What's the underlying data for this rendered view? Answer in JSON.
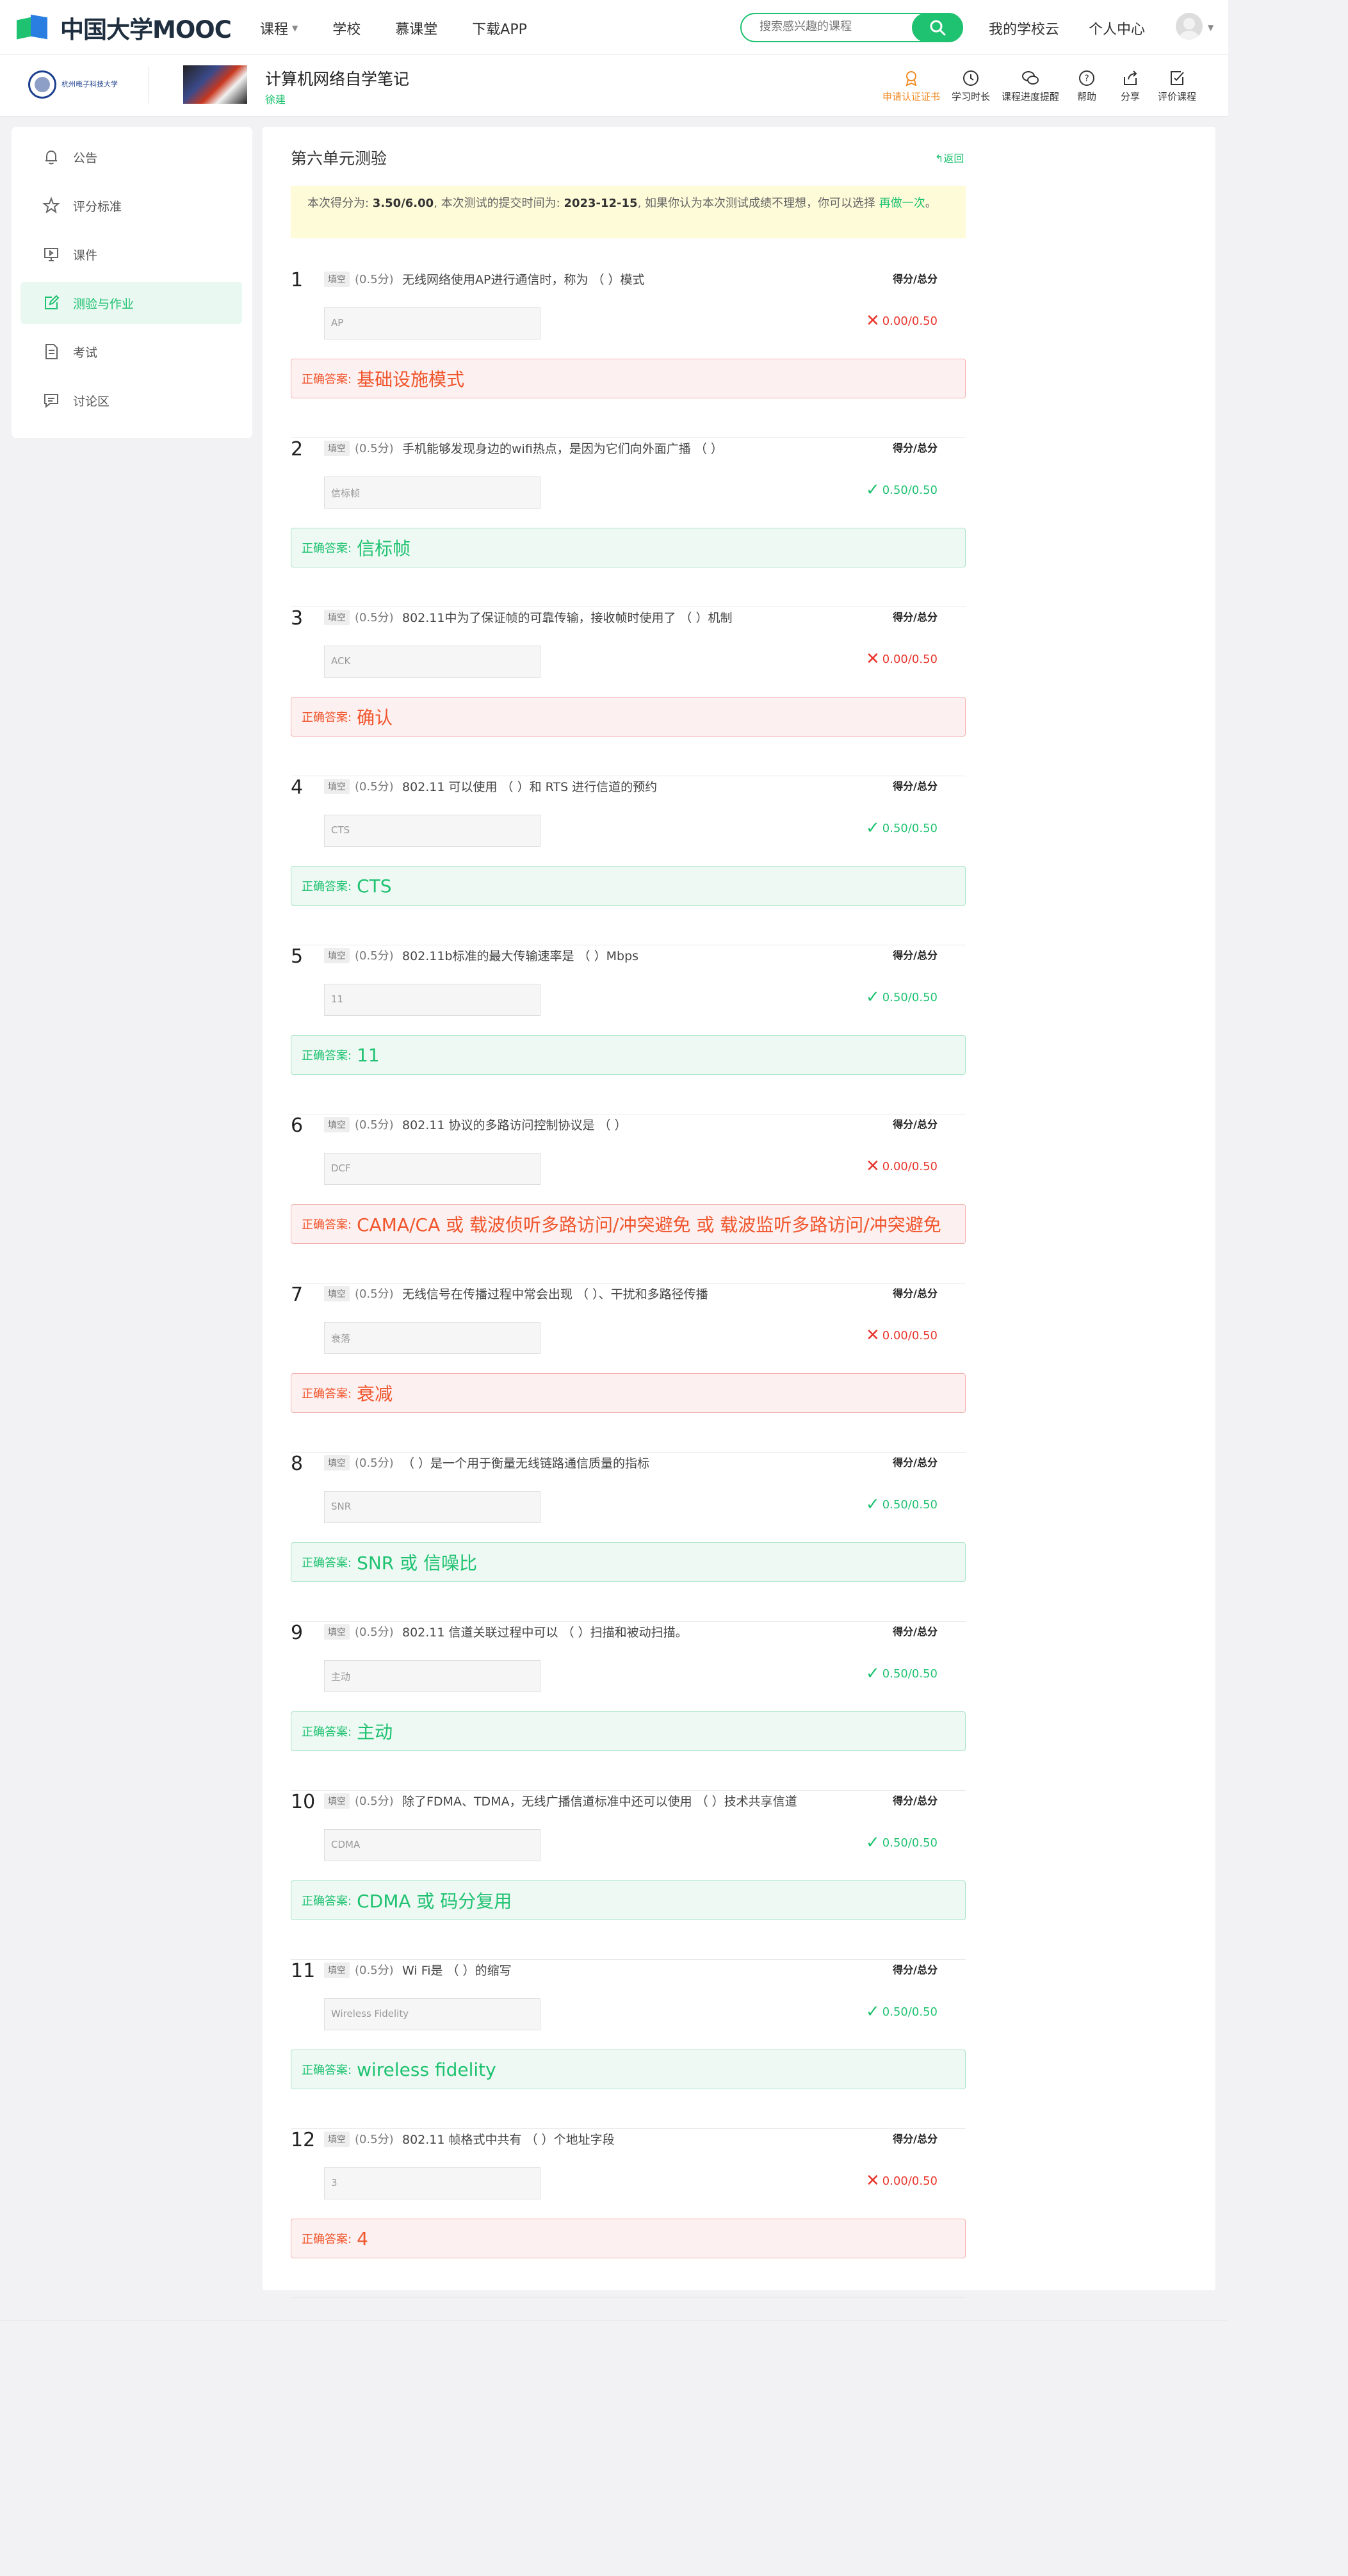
{
  "brand": {
    "name": "中国大学MOOC",
    "accent": "#1fc270",
    "wrong_color": "#e8352c"
  },
  "topnav": [
    {
      "label": "课程",
      "has_caret": true
    },
    {
      "label": "学校"
    },
    {
      "label": "慕课堂"
    },
    {
      "label": "下载APP"
    }
  ],
  "search": {
    "placeholder": "搜索感兴趣的课程"
  },
  "topright": [
    "我的学校云",
    "个人中心"
  ],
  "course": {
    "school_name": "杭州电子科技大学",
    "title": "计算机网络自学笔记",
    "teacher": "徐建"
  },
  "tools": [
    {
      "label": "申请认证证书",
      "icon": "certificate-icon"
    },
    {
      "label": "学习时长",
      "icon": "clock-icon"
    },
    {
      "label": "课程进度提醒",
      "icon": "wechat-icon"
    },
    {
      "label": "帮助",
      "icon": "help-icon"
    },
    {
      "label": "分享",
      "icon": "share-icon"
    },
    {
      "label": "评价课程",
      "icon": "review-icon"
    }
  ],
  "sidebar": [
    {
      "label": "公告",
      "icon": "bell-icon"
    },
    {
      "label": "评分标准",
      "icon": "star-icon"
    },
    {
      "label": "课件",
      "icon": "courseware-icon"
    },
    {
      "label": "测验与作业",
      "icon": "edit-icon",
      "active": true
    },
    {
      "label": "考试",
      "icon": "exam-icon"
    },
    {
      "label": "讨论区",
      "icon": "discussion-icon"
    }
  ],
  "quiz": {
    "title": "第六单元测验",
    "back_label": "返回",
    "banner": {
      "prefix": "本次得分为: ",
      "score": "3.50/6.00",
      "mid": ", 本次测试的提交时间为: ",
      "date": "2023-12-15",
      "suffix": ", 如果你认为本次测试成绩不理想，你可以选择 ",
      "retry": "再做一次",
      "end": "。"
    },
    "tag_label": "填空",
    "score_label": "(0.5分)",
    "result_label": "得分/总分",
    "answer_label": "正确答案:",
    "questions": [
      {
        "num": "1",
        "text": "无线网络使用AP进行通信时，称为 （ ）模式",
        "input": "AP",
        "result": "0.00/0.50",
        "correct": false,
        "answer": "基础设施模式"
      },
      {
        "num": "2",
        "text": "手机能够发现身边的wifi热点，是因为它们向外面广播 （ ）",
        "input": "信标帧",
        "result": "0.50/0.50",
        "correct": true,
        "answer": "信标帧"
      },
      {
        "num": "3",
        "text": "802.11中为了保证帧的可靠传输，接收帧时使用了 （ ）机制",
        "input": "ACK",
        "result": "0.00/0.50",
        "correct": false,
        "answer": "确认"
      },
      {
        "num": "4",
        "text": "802.11 可以使用 （ ）和 RTS 进行信道的预约",
        "input": "CTS",
        "result": "0.50/0.50",
        "correct": true,
        "answer": "CTS"
      },
      {
        "num": "5",
        "text": "802.11b标准的最大传输速率是 （ ）Mbps",
        "input": "11",
        "result": "0.50/0.50",
        "correct": true,
        "answer": "11"
      },
      {
        "num": "6",
        "text": "802.11 协议的多路访问控制协议是 （ ）",
        "input": "DCF",
        "result": "0.00/0.50",
        "correct": false,
        "answer": "CAMA/CA 或 载波侦听多路访问/冲突避免 或 载波监听多路访问/冲突避免"
      },
      {
        "num": "7",
        "text": "无线信号在传播过程中常会出现 （ ）、干扰和多路径传播",
        "input": "衰落",
        "result": "0.00/0.50",
        "correct": false,
        "answer": "衰减"
      },
      {
        "num": "8",
        "text": "（ ）是一个用于衡量无线链路通信质量的指标",
        "input": "SNR",
        "result": "0.50/0.50",
        "correct": true,
        "answer": "SNR 或 信噪比"
      },
      {
        "num": "9",
        "text": "802.11 信道关联过程中可以 （ ）扫描和被动扫描。",
        "input": "主动",
        "result": "0.50/0.50",
        "correct": true,
        "answer": "主动"
      },
      {
        "num": "10",
        "text": "除了FDMA、TDMA，无线广播信道标准中还可以使用 （ ）技术共享信道",
        "input": "CDMA",
        "result": "0.50/0.50",
        "correct": true,
        "answer": "CDMA 或 码分复用"
      },
      {
        "num": "11",
        "text": "Wi Fi是 （ ）的缩写",
        "input": "Wireless Fidelity",
        "result": "0.50/0.50",
        "correct": true,
        "answer": "wireless fidelity"
      },
      {
        "num": "12",
        "text": "802.11 帧格式中共有 （ ）个地址字段",
        "input": "3",
        "result": "0.00/0.50",
        "correct": false,
        "answer": "4"
      }
    ]
  }
}
